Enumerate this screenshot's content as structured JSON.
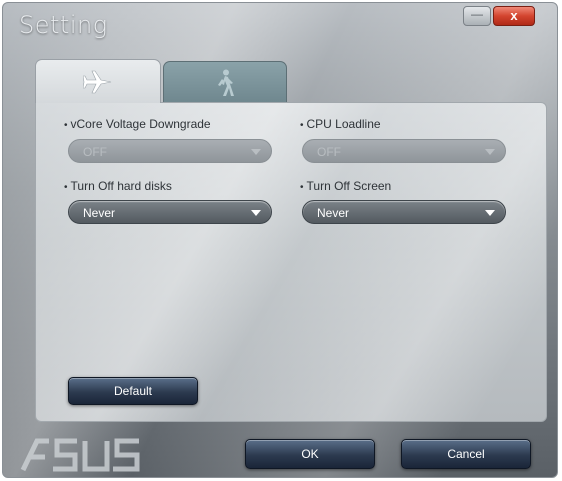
{
  "window": {
    "title": "Setting",
    "minimize_glyph": "—",
    "close_glyph": "x"
  },
  "tabs": [
    {
      "icon": "airplane-icon",
      "active": true
    },
    {
      "icon": "walking-person-icon",
      "active": false
    }
  ],
  "fields": {
    "vcore": {
      "label": "vCore Voltage Downgrade",
      "value": "OFF",
      "enabled": false
    },
    "cpu_loadline": {
      "label": "CPU Loadline",
      "value": "OFF",
      "enabled": false
    },
    "hard_disks": {
      "label": "Turn Off hard disks",
      "value": "Never",
      "enabled": true
    },
    "screen": {
      "label": "Turn Off Screen",
      "value": "Never",
      "enabled": true
    }
  },
  "bullet": "•",
  "buttons": {
    "default": "Default",
    "ok": "OK",
    "cancel": "Cancel"
  },
  "brand": {
    "logo": "ASUS",
    "logo_icon": "asus-logo"
  },
  "colors": {
    "close_button": "#d3442f",
    "dark_button": "#2c3a4f",
    "active_tab": "#e9ecee",
    "inactive_tab": "#7a939a"
  }
}
